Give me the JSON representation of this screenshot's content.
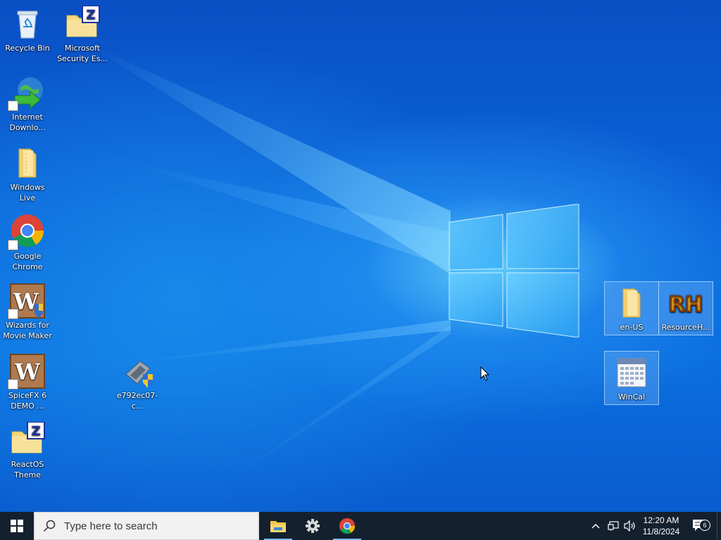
{
  "desktop": {
    "icons": [
      {
        "label": "Recycle Bin",
        "icon": "recycle-bin-icon"
      },
      {
        "label": "Microsoft Security Es...",
        "icon": "zip-folder-icon"
      },
      {
        "label": "Internet Downlo...",
        "icon": "idm-globe-icon"
      },
      {
        "label": "Windows Live",
        "icon": "folder-icon"
      },
      {
        "label": "Google Chrome",
        "icon": "chrome-icon"
      },
      {
        "label": "Wizards for Movie Maker",
        "icon": "wizards-icon"
      },
      {
        "label": "SpiceFX 6 DEMO ...",
        "icon": "wizards-icon"
      },
      {
        "label": "ReactOS Theme",
        "icon": "zip-folder-icon"
      },
      {
        "label": "e792ec07-c...",
        "icon": "installer-icon"
      },
      {
        "label": "en-US",
        "icon": "folder-icon"
      },
      {
        "label": "ResourceH...",
        "icon": "rh-icon"
      },
      {
        "label": "WinCal",
        "icon": "calendar-icon"
      }
    ]
  },
  "taskbar": {
    "start": "windows-logo-icon",
    "search_placeholder": "Type here to search",
    "pinned_apps": [
      "file-explorer-icon",
      "settings-gear-icon",
      "chrome-icon"
    ],
    "tray": {
      "icons": [
        "chevron-up-icon",
        "network-icon",
        "volume-icon"
      ],
      "time": "12:20 AM",
      "date": "11/8/2024",
      "notification_count": "6"
    }
  },
  "colors": {
    "wallpaper": "#0a5fd6",
    "taskbar": "#15202e",
    "search_box": "#f1f1f1",
    "active_indicator": "#76b9ed"
  }
}
